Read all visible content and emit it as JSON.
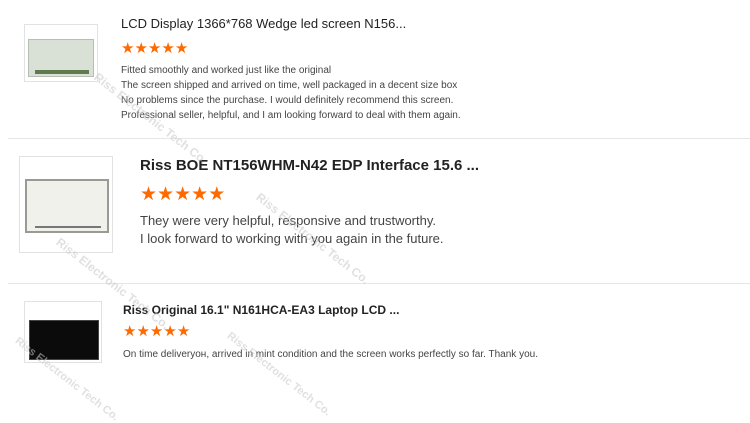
{
  "reviews": [
    {
      "title": "LCD Display 1366*768 Wedge led screen N156...",
      "stars": [
        "★",
        "★",
        "★",
        "★",
        "★"
      ],
      "comment_lines": [
        "Fitted smoothly and worked just like the original",
        "The screen shipped and arrived on time, well packaged in a decent size box",
        "No problems since the purchase. I would definitely recommend this screen.",
        "Professional seller, helpful, and I am looking forward to deal with them again."
      ]
    },
    {
      "title": "Riss BOE NT156WHM-N42 EDP Interface 15.6 ...",
      "stars": [
        "★",
        "★",
        "★",
        "★",
        "★"
      ],
      "comment_lines": [
        "They were very helpful, responsive and trustworthy.",
        "I look forward to working with you again in the future."
      ]
    },
    {
      "title": "Riss Original 16.1\" N161HCA-EA3 Laptop LCD ...",
      "stars": [
        "★",
        "★",
        "★",
        "★",
        "★"
      ],
      "comment_lines": [
        "On time deliveryон, arrived in mint condition and the screen works perfectly so far. Thank you."
      ]
    }
  ],
  "watermark": "Riss Electronic Tech Co.",
  "colors": {
    "star": "#ff6a00",
    "divider": "#e6e6e6"
  }
}
